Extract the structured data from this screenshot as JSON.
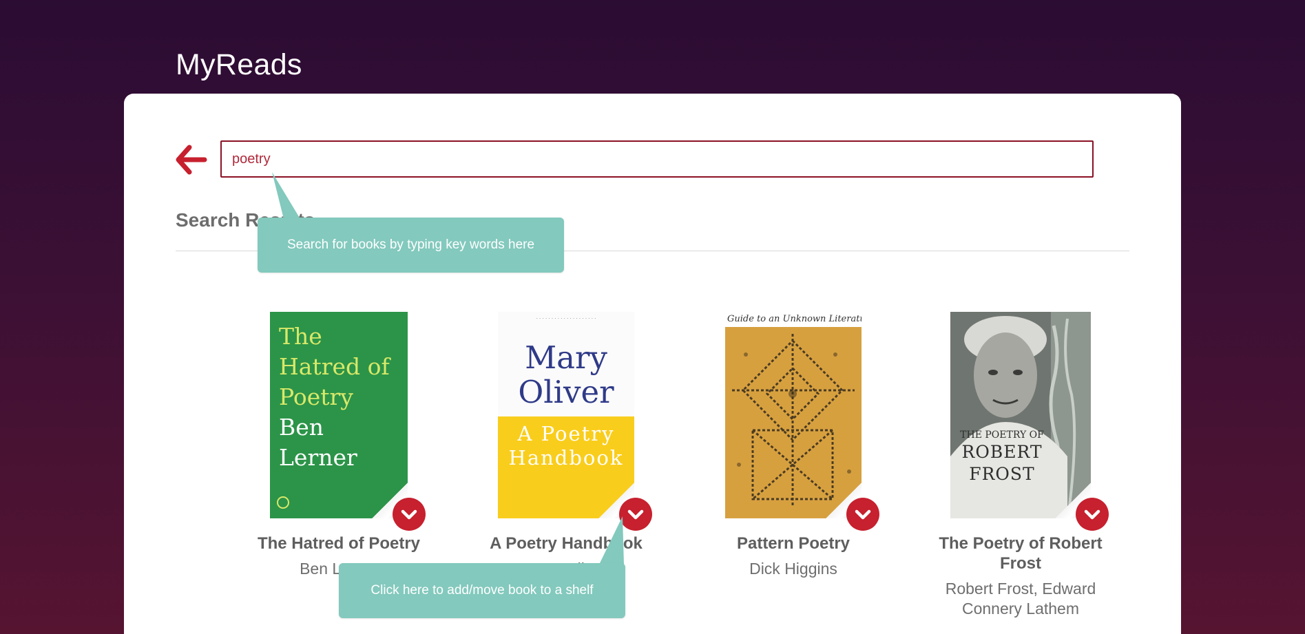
{
  "app": {
    "title": "MyReads"
  },
  "search": {
    "value": "poetry",
    "placeholder": ""
  },
  "results": {
    "title": "Search Results"
  },
  "tooltips": {
    "search_hint": "Search for books by typing key words here",
    "shelf_hint": "Click here to add/move book to a shelf"
  },
  "books": [
    {
      "title": "The Hatred of Poetry",
      "authors": "Ben Lerner",
      "cover_lines": [
        "The",
        "Hatred of",
        "Poetry",
        "Ben",
        "Lerner"
      ]
    },
    {
      "title": "A Poetry Handbook",
      "authors": "Mary Oliver",
      "cover_lines": [
        "Mary",
        "Oliver",
        "A Poetry",
        "Handbook"
      ]
    },
    {
      "title": "Pattern Poetry",
      "authors": "Dick Higgins",
      "cover_lines": [
        "Guide to an Unknown Literature"
      ]
    },
    {
      "title": "The Poetry of Robert Frost",
      "authors": "Robert Frost, Edward Connery Lathem",
      "cover_lines": [
        "THE POETRY OF",
        "ROBERT",
        "FROST"
      ]
    }
  ],
  "colors": {
    "accent": "#c7202e",
    "tooltip": "#83c9bd",
    "input_border": "#8a1124"
  },
  "icons": {
    "back": "arrow-left-icon",
    "shelf": "chevron-down-icon"
  }
}
